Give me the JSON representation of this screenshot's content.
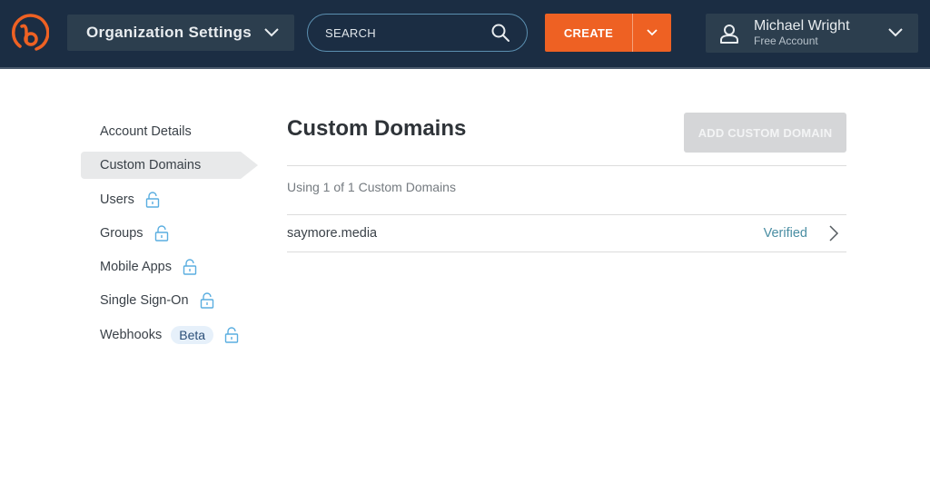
{
  "header": {
    "logo": "bitly-logo-icon",
    "org_selector_label": "Organization Settings",
    "search_placeholder": "SEARCH",
    "search_value": "",
    "create_label": "CREATE",
    "user_name": "Michael Wright",
    "user_plan": "Free Account"
  },
  "sidebar": {
    "items": [
      {
        "label": "Account Details",
        "locked": false,
        "active": false
      },
      {
        "label": "Custom Domains",
        "locked": false,
        "active": true
      },
      {
        "label": "Users",
        "locked": true,
        "active": false
      },
      {
        "label": "Groups",
        "locked": true,
        "active": false
      },
      {
        "label": "Mobile Apps",
        "locked": true,
        "active": false
      },
      {
        "label": "Single Sign-On",
        "locked": true,
        "active": false
      },
      {
        "label": "Webhooks",
        "locked": true,
        "active": false,
        "badge": "Beta"
      }
    ]
  },
  "main": {
    "title": "Custom Domains",
    "add_button_label": "ADD CUSTOM DOMAIN",
    "usage_text": "Using 1 of 1 Custom Domains",
    "domains": [
      {
        "name": "saymore.media",
        "status": "Verified"
      }
    ]
  },
  "colors": {
    "header_bg": "#1b2d43",
    "accent_orange": "#ee6123",
    "verified_text": "#4a8ea3",
    "lock_icon": "#5aaee0"
  }
}
